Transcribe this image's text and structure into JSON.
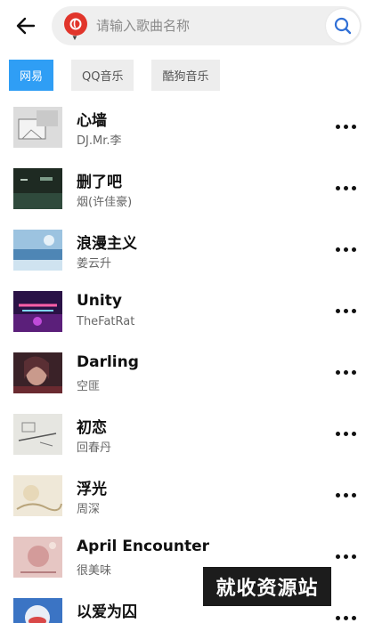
{
  "search": {
    "placeholder": "请输入歌曲名称",
    "source_logo_color": "#e1352b"
  },
  "tabs": [
    {
      "label": "网易",
      "active": true
    },
    {
      "label": "QQ音乐",
      "active": false
    },
    {
      "label": "酷狗音乐",
      "active": false
    }
  ],
  "accent_color": "#2f9ef5",
  "songs": [
    {
      "title": "心墙",
      "artist": "DJ.Mr.李",
      "cover": "light-gray-sketch"
    },
    {
      "title": "删了吧",
      "artist": "烟(许佳豪)",
      "cover": "dark-green"
    },
    {
      "title": "浪漫主义",
      "artist": "姜云升",
      "cover": "blue-sky"
    },
    {
      "title": "Unity",
      "artist": "TheFatRat",
      "cover": "neon-purple-tfr"
    },
    {
      "title": "Darling",
      "artist": "空匪",
      "cover": "dark-red-portrait"
    },
    {
      "title": "初恋",
      "artist": "回春丹",
      "cover": "pale-sketch"
    },
    {
      "title": "浮光",
      "artist": "周深",
      "cover": "cream-painting"
    },
    {
      "title": "April Encounter",
      "artist": "很美味",
      "cover": "pink-pastel"
    },
    {
      "title": "以爱为囚",
      "artist": "",
      "cover": "blue-red-orb"
    }
  ],
  "watermark": {
    "text": "就收资源站"
  }
}
